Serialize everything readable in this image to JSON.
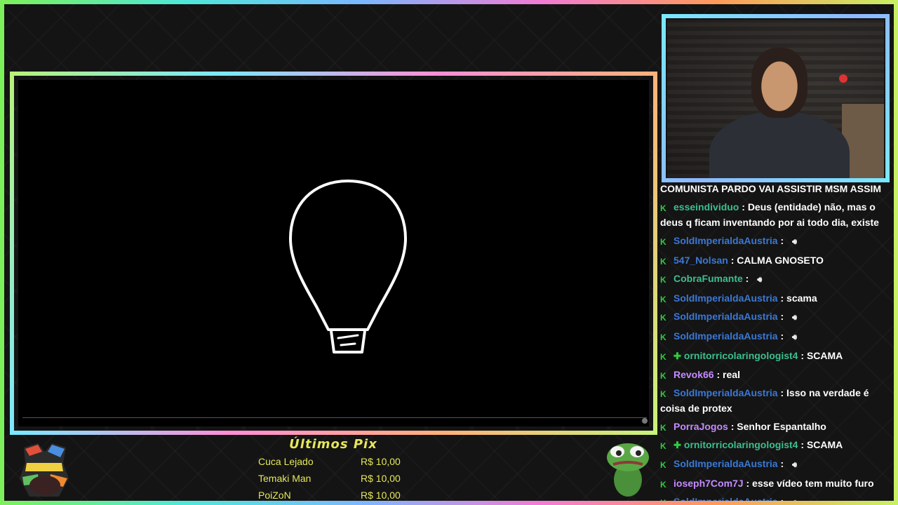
{
  "chat": {
    "header_line": "COMUNISTA PARDO VAI ASSISTIR MSM ASSIM",
    "messages": [
      {
        "user": "esseindividuo",
        "color": "#3dbf8f",
        "text": "Deus (entidade) não, mas o deus q ficam inventando por ai todo dia, existe",
        "extra_badge": false,
        "speaker": false
      },
      {
        "user": "SoldImperialdaAustria",
        "color": "#3a78d6",
        "text": "",
        "extra_badge": false,
        "speaker": true
      },
      {
        "user": "547_Nolsan",
        "color": "#3a78d6",
        "text": "CALMA GNOSETO",
        "extra_badge": false,
        "speaker": false
      },
      {
        "user": "CobraFumante",
        "color": "#3dbf8f",
        "text": "",
        "extra_badge": false,
        "speaker": true
      },
      {
        "user": "SoldImperialdaAustria",
        "color": "#3a78d6",
        "text": "scama",
        "extra_badge": false,
        "speaker": false
      },
      {
        "user": "SoldImperialdaAustria",
        "color": "#3a78d6",
        "text": "",
        "extra_badge": false,
        "speaker": true
      },
      {
        "user": "SoldImperialdaAustria",
        "color": "#3a78d6",
        "text": "",
        "extra_badge": false,
        "speaker": true
      },
      {
        "user": "ornitorricolaringologist4",
        "color": "#3dbf8f",
        "text": "SCAMA",
        "extra_badge": true,
        "speaker": false
      },
      {
        "user": "Revok66",
        "color": "#c58bff",
        "text": "real",
        "extra_badge": false,
        "speaker": false
      },
      {
        "user": "SoldImperialdaAustria",
        "color": "#3a78d6",
        "text": "Isso na verdade é coisa de protex",
        "extra_badge": false,
        "speaker": false
      },
      {
        "user": "PorraJogos",
        "color": "#c58bff",
        "text": "Senhor Espantalho",
        "extra_badge": false,
        "speaker": false
      },
      {
        "user": "ornitorricolaringologist4",
        "color": "#3dbf8f",
        "text": "SCAMA",
        "extra_badge": true,
        "speaker": false
      },
      {
        "user": "SoldImperialdaAustria",
        "color": "#3a78d6",
        "text": "",
        "extra_badge": false,
        "speaker": true
      },
      {
        "user": "ioseph7Com7J",
        "color": "#c58bff",
        "text": "esse vídeo tem muito furo",
        "extra_badge": false,
        "speaker": false
      },
      {
        "user": "SoldImperialdaAustria",
        "color": "#3a78d6",
        "text": "",
        "extra_badge": false,
        "speaker": true
      }
    ]
  },
  "pix": {
    "title": "Últimos Pix",
    "rows": [
      {
        "name": "Cuca Lejado",
        "value": "R$ 10,00"
      },
      {
        "name": "Temaki Man",
        "value": "R$ 10,00"
      },
      {
        "name": "PoiZoN",
        "value": "R$ 10,00"
      }
    ]
  },
  "icons": {
    "chat_badge": "k-icon",
    "chat_badge_extra": "plus-icon",
    "speaker": "speaker-icon"
  }
}
